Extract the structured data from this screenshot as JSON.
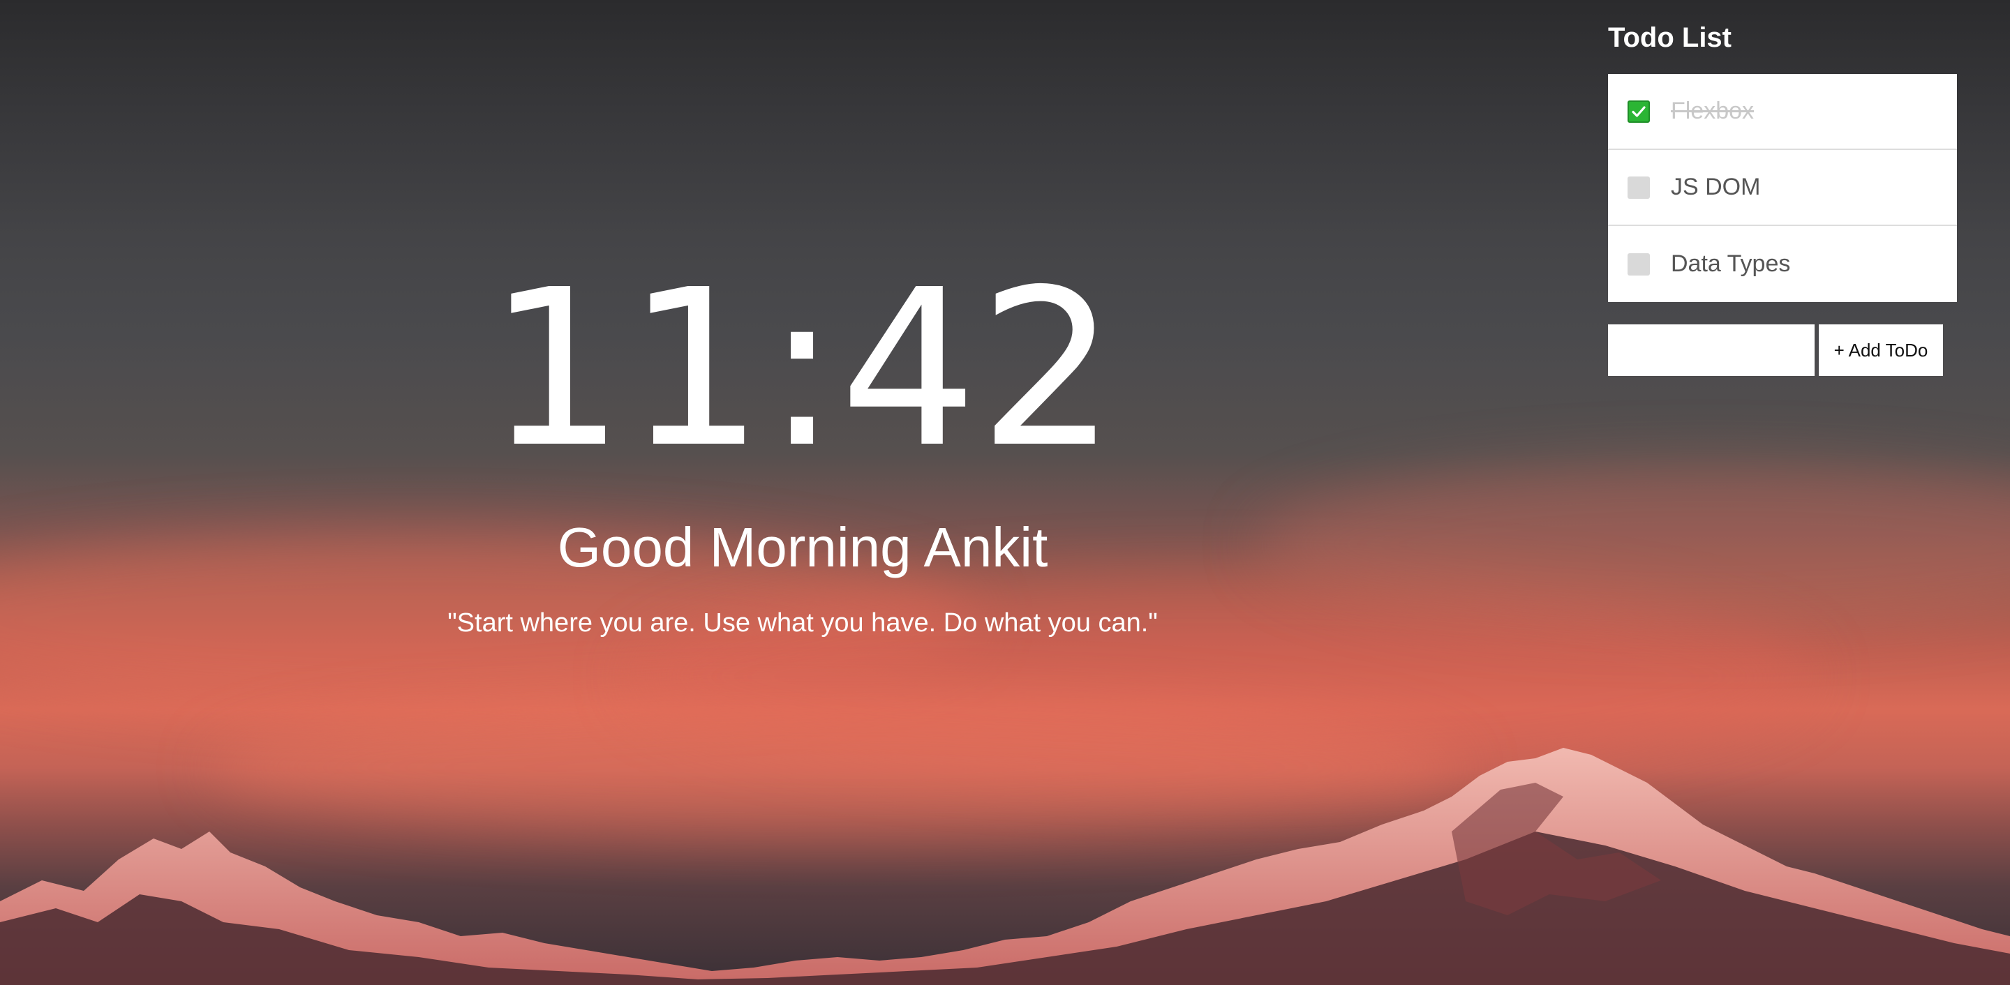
{
  "clock": {
    "time": "11:42"
  },
  "greeting": {
    "text": "Good Morning Ankit"
  },
  "quote": {
    "text": "\"Start where you are. Use what you have. Do what you can.\""
  },
  "todo": {
    "title": "Todo List",
    "items": [
      {
        "label": "Flexbox",
        "done": true
      },
      {
        "label": "JS DOM",
        "done": false
      },
      {
        "label": "Data Types",
        "done": false
      }
    ],
    "input_value": "",
    "input_placeholder": "",
    "add_button_label": "+ Add ToDo"
  },
  "colors": {
    "text": "#ffffff",
    "checkbox_checked": "#2bb534",
    "checkbox_unchecked": "#d9d9d9",
    "done_text": "#c8c8c8",
    "todo_text": "#555555"
  },
  "icons": {
    "checked": "check-icon"
  }
}
